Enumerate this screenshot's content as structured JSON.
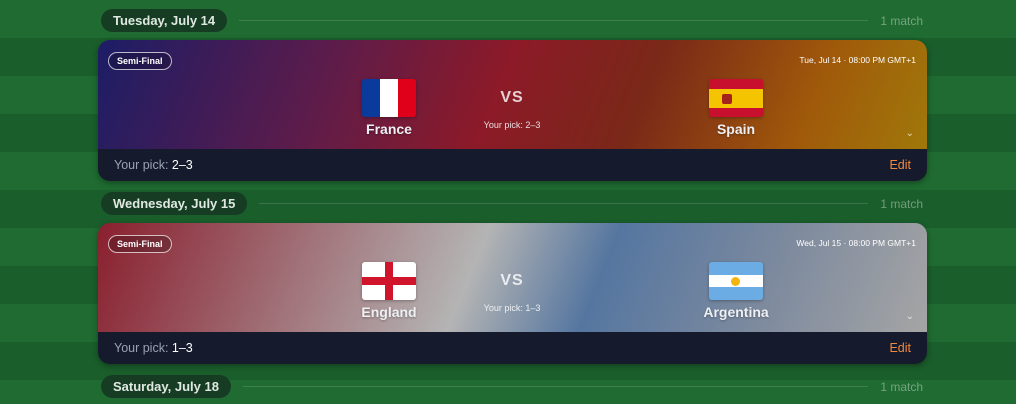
{
  "days": [
    {
      "date_label": "Tuesday, July 14",
      "count": "1 match"
    },
    {
      "date_label": "Wednesday, July 15",
      "count": "1 match"
    },
    {
      "date_label": "Saturday, July 18",
      "count": "1 match"
    }
  ],
  "matches": [
    {
      "round": "Semi-Final",
      "kickoff": "Tue, Jul 14 · 08:00 PM GMT+1",
      "home": {
        "name": "France",
        "flag": "france-flag"
      },
      "away": {
        "name": "Spain",
        "flag": "spain-flag"
      },
      "vs": "VS",
      "mini_pick": "Your pick: 2–3",
      "pick_label": "Your pick:",
      "pick_value": "2–3",
      "edit_label": "Edit",
      "chevron": "⌄"
    },
    {
      "round": "Semi-Final",
      "kickoff": "Wed, Jul 15 · 08:00 PM GMT+1",
      "home": {
        "name": "England",
        "flag": "england-flag"
      },
      "away": {
        "name": "Argentina",
        "flag": "argentina-flag"
      },
      "vs": "VS",
      "mini_pick": "Your pick: 1–3",
      "pick_label": "Your pick:",
      "pick_value": "1–3",
      "edit_label": "Edit",
      "chevron": "⌄"
    }
  ],
  "colors": {
    "accent_edit": "#f08a3c",
    "footer_bg": "#151a2c",
    "day_pill_bg": "#163d23"
  }
}
